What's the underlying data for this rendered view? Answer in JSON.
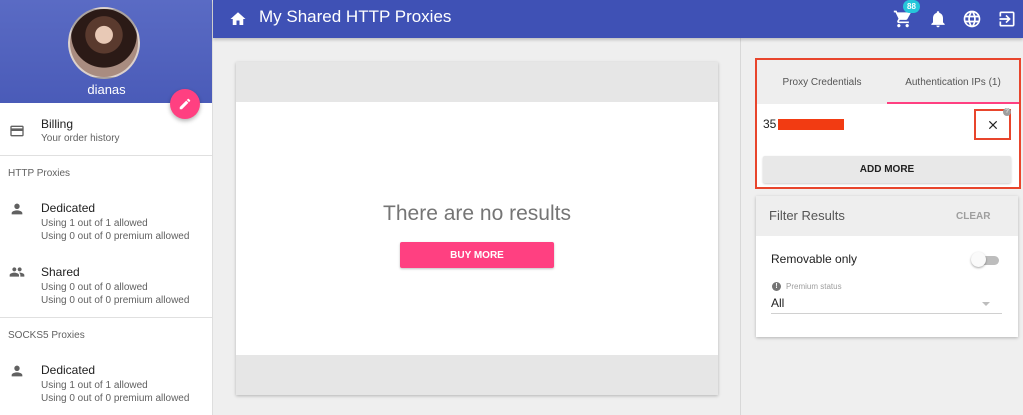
{
  "header": {
    "title": "My Shared HTTP Proxies",
    "cart_count": "88"
  },
  "profile": {
    "username": "dianas"
  },
  "sidebar": {
    "billing": {
      "title": "Billing",
      "subtitle": "Your order history"
    },
    "http_section": "HTTP Proxies",
    "http_dedicated": {
      "title": "Dedicated",
      "line1": "Using 1 out of 1 allowed",
      "line2": "Using 0 out of 0 premium allowed"
    },
    "http_shared": {
      "title": "Shared",
      "line1": "Using 0 out of 0 allowed",
      "line2": "Using 0 out of 0 premium allowed"
    },
    "socks_section": "SOCKS5 Proxies",
    "socks_dedicated": {
      "title": "Dedicated",
      "line1": "Using 1 out of 1 allowed",
      "line2": "Using 0 out of 0 premium allowed"
    }
  },
  "main": {
    "empty_message": "There are no results",
    "buy_more_label": "BUY MORE"
  },
  "auth_panel": {
    "tabs": [
      {
        "label": "Proxy Credentials",
        "active": false
      },
      {
        "label": "Authentication IPs (1)",
        "active": true
      }
    ],
    "ip_prefix": "35",
    "add_more_label": "ADD MORE",
    "help_glyph": "?"
  },
  "filter": {
    "title": "Filter Results",
    "clear_label": "CLEAR",
    "removable_label": "Removable only",
    "removable_on": false,
    "premium_label": "Premium status",
    "premium_value": "All"
  },
  "colors": {
    "primary": "#3f51b5",
    "accent": "#ff4081",
    "highlight": "#e8452c",
    "badge": "#26c6da"
  }
}
